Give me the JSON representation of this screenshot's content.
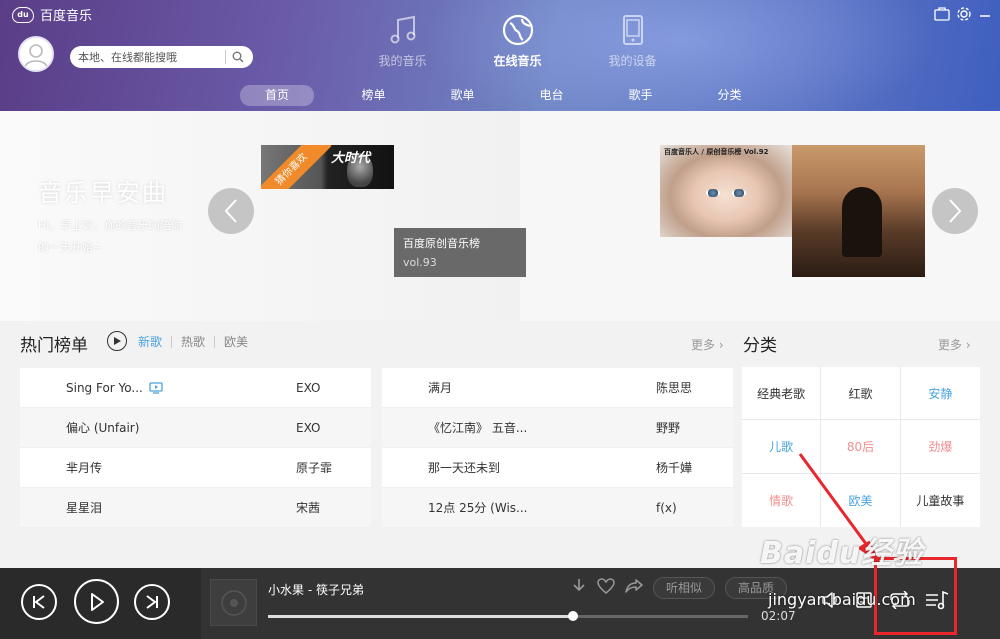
{
  "app": {
    "title": "百度音乐",
    "logo_text": "du"
  },
  "search": {
    "placeholder": "本地、在线都能搜哦"
  },
  "main_tabs": [
    {
      "label": "我的音乐",
      "icon": "music-note-icon"
    },
    {
      "label": "在线音乐",
      "icon": "globe-icon",
      "active": true
    },
    {
      "label": "我的设备",
      "icon": "phone-icon"
    }
  ],
  "sub_nav": [
    "首页",
    "榜单",
    "歌单",
    "电台",
    "歌手",
    "分类"
  ],
  "banner": {
    "title": "音乐早安曲",
    "text": "Hi，早上好，你的音乐Dj陪你的一天开始~",
    "ribbon": "猜你喜欢",
    "thumb_script": "大时代",
    "caption_title": "百度原创音乐榜",
    "caption_vol": "vol.93",
    "thumb_header": "百度音乐人 / 原创音乐榜 Vol.92"
  },
  "hot": {
    "title": "热门榜单",
    "filters": [
      "新歌",
      "热歌",
      "欧美"
    ],
    "more": "更多"
  },
  "songs_left": [
    {
      "title": "Sing For Yo...",
      "artist": "EXO",
      "mv": true
    },
    {
      "title": "偏心 (Unfair)",
      "artist": "EXO"
    },
    {
      "title": "芈月传",
      "artist": "原子霏"
    },
    {
      "title": "星星泪",
      "artist": "宋茜"
    }
  ],
  "songs_right": [
    {
      "title": "满月",
      "artist": "陈思思"
    },
    {
      "title": "《忆江南》 五音...",
      "artist": "野野"
    },
    {
      "title": "那一天还未到",
      "artist": "杨千嬅"
    },
    {
      "title": "12点 25分 (Wis...",
      "artist": "f(x)"
    }
  ],
  "categories": {
    "title": "分类",
    "more": "更多",
    "items": [
      {
        "label": "经典老歌",
        "color": "#333333"
      },
      {
        "label": "红歌",
        "color": "#333333"
      },
      {
        "label": "安静",
        "color": "#4aa3df"
      },
      {
        "label": "儿歌",
        "color": "#4aa3df"
      },
      {
        "label": "80后",
        "color": "#f08f8f"
      },
      {
        "label": "劲爆",
        "color": "#f08f8f"
      },
      {
        "label": "情歌",
        "color": "#f08f8f"
      },
      {
        "label": "欧美",
        "color": "#4aa3df"
      },
      {
        "label": "儿童故事",
        "color": "#333333"
      }
    ]
  },
  "player": {
    "track": "小水果 - 筷子兄弟",
    "similar": "听相似",
    "quality": "高品质",
    "time": "02:07",
    "progress": 0.635
  },
  "watermark": {
    "main": "Baidu经验",
    "url": "jingyan.baidu.com"
  },
  "colors": {
    "accent": "#4aa3df",
    "highlight": "#e8262c"
  }
}
